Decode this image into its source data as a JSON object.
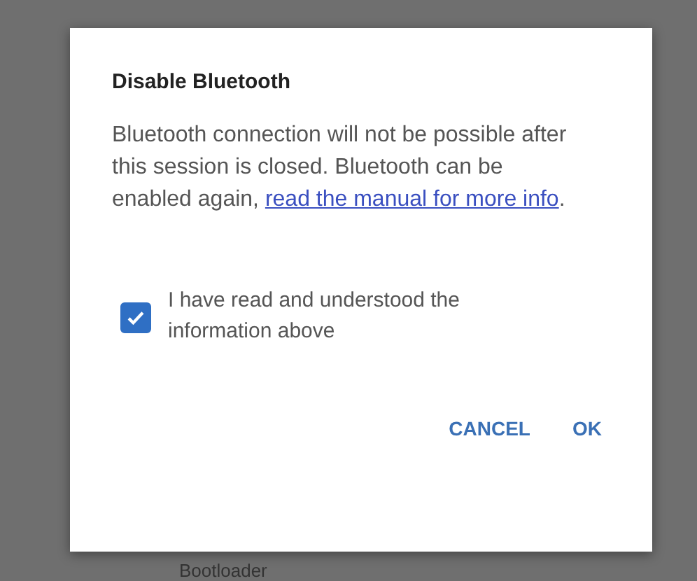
{
  "dialog": {
    "title": "Disable Bluetooth",
    "message": "Bluetooth connection will not be possible after this session is closed. Bluetooth can be enabled again, ",
    "link": "read the manual for more info",
    "message_end": ".",
    "checkbox": {
      "label": "I have read and understood the information above",
      "checked": true
    },
    "buttons": [
      "CANCEL",
      "OK"
    ]
  },
  "background": {
    "label": "Bootloader"
  }
}
